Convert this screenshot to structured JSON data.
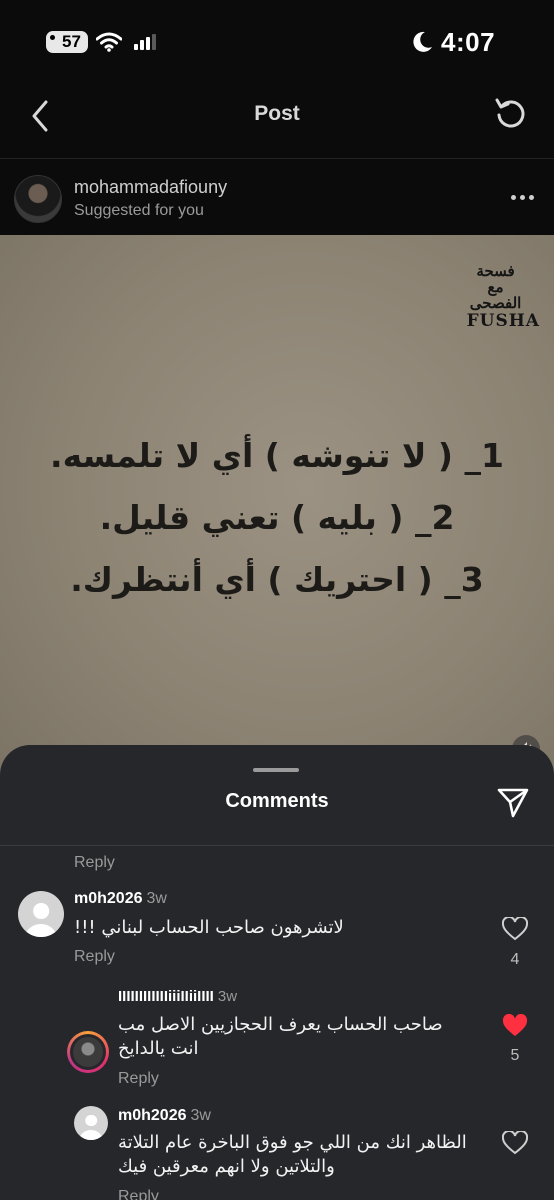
{
  "status_bar": {
    "battery": "57",
    "time": "4:07"
  },
  "nav": {
    "title": "Post"
  },
  "post": {
    "username": "mohammadafiouny",
    "subtitle": "Suggested for you",
    "logo_ar": "فسحة مع الفصحى",
    "logo_en": "FUSHA",
    "lines": [
      "1_ ( لا تنوشه ) أي لا تلمسه.",
      "2_ ( بليه ) تعني قليل.",
      "3_ ( احتريك ) أي أنتظرك."
    ]
  },
  "comments_sheet": {
    "title": "Comments",
    "top_reply": "Reply",
    "comments": [
      {
        "username": "m0h2026",
        "time": "3w",
        "text": "لاتشرهون صاحب الحساب لبناني !!!",
        "reply": "Reply",
        "likes": "4",
        "liked": false
      },
      {
        "username": "IIIIIIIIIIIIiiiIIiiIIII",
        "time": "3w",
        "text": "صاحب الحساب يعرف الحجازيين الاصل مب انت يالدايخ",
        "reply": "Reply",
        "likes": "5",
        "liked": true
      },
      {
        "username": "m0h2026",
        "time": "3w",
        "text": "الظاهر انك من اللي جو فوق الباخرة عام التلاتة والتلاتين ولا انهم معرقين فيك",
        "reply": "Reply",
        "likes": "",
        "liked": false
      }
    ]
  },
  "colors": {
    "liked_heart": "#ff3040",
    "sheet_bg": "#26272b",
    "page_bg": "#0b0b0c"
  },
  "icons": [
    "back-chevron-icon",
    "refresh-icon",
    "more-dots-icon",
    "mute-icon",
    "share-send-icon",
    "heart-icon",
    "heart-filled-icon",
    "wifi-icon",
    "cellular-icon",
    "moon-icon"
  ]
}
